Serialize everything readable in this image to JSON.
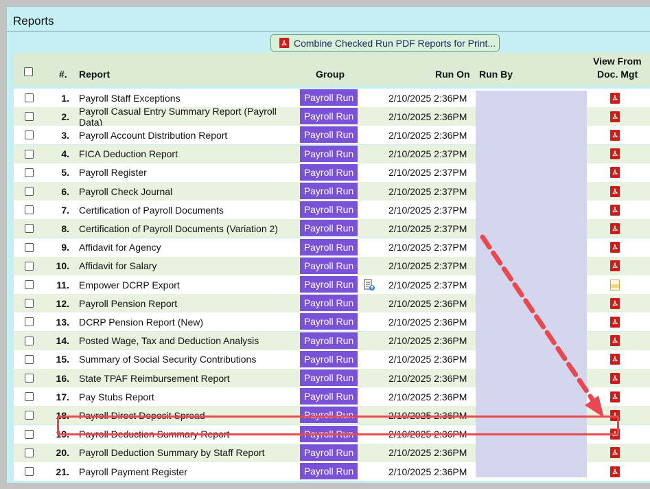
{
  "panel": {
    "title": "Reports"
  },
  "toolbar": {
    "combine_label": "Combine Checked Run PDF Reports for Print..."
  },
  "table": {
    "headers": {
      "num": "#.",
      "report": "Report",
      "group": "Group",
      "run_on": "Run On",
      "run_by": "Run By",
      "view_line1": "View From",
      "view_line2": "Doc. Mgt"
    },
    "rows": [
      {
        "num": "1.",
        "report": "Payroll Staff Exceptions",
        "group": "Payroll Run",
        "run_on": "2/10/2025 2:36PM",
        "file": "pdf"
      },
      {
        "num": "2.",
        "report": "Payroll Casual Entry Summary Report (Payroll Data)",
        "group": "Payroll Run",
        "run_on": "2/10/2025 2:36PM",
        "file": "pdf"
      },
      {
        "num": "3.",
        "report": "Payroll Account Distribution Report",
        "group": "Payroll Run",
        "run_on": "2/10/2025 2:36PM",
        "file": "pdf"
      },
      {
        "num": "4.",
        "report": "FICA Deduction Report",
        "group": "Payroll Run",
        "run_on": "2/10/2025 2:37PM",
        "file": "pdf"
      },
      {
        "num": "5.",
        "report": "Payroll Register",
        "group": "Payroll Run",
        "run_on": "2/10/2025 2:37PM",
        "file": "pdf"
      },
      {
        "num": "6.",
        "report": "Payroll Check Journal",
        "group": "Payroll Run",
        "run_on": "2/10/2025 2:37PM",
        "file": "pdf"
      },
      {
        "num": "7.",
        "report": "Certification of Payroll Documents",
        "group": "Payroll Run",
        "run_on": "2/10/2025 2:37PM",
        "file": "pdf"
      },
      {
        "num": "8.",
        "report": "Certification of Payroll Documents (Variation 2)",
        "group": "Payroll Run",
        "run_on": "2/10/2025 2:37PM",
        "file": "pdf"
      },
      {
        "num": "9.",
        "report": "Affidavit for Agency",
        "group": "Payroll Run",
        "run_on": "2/10/2025 2:37PM",
        "file": "pdf"
      },
      {
        "num": "10.",
        "report": "Affidavit for Salary",
        "group": "Payroll Run",
        "run_on": "2/10/2025 2:37PM",
        "file": "pdf"
      },
      {
        "num": "11.",
        "report": "Empower DCRP Export",
        "group": "Payroll Run",
        "run_on": "2/10/2025 2:37PM",
        "file": "csv",
        "extra_icon": true
      },
      {
        "num": "12.",
        "report": "Payroll Pension Report",
        "group": "Payroll Run",
        "run_on": "2/10/2025 2:36PM",
        "file": "pdf"
      },
      {
        "num": "13.",
        "report": "DCRP Pension Report (New)",
        "group": "Payroll Run",
        "run_on": "2/10/2025 2:36PM",
        "file": "pdf"
      },
      {
        "num": "14.",
        "report": "Posted Wage, Tax and Deduction Analysis",
        "group": "Payroll Run",
        "run_on": "2/10/2025 2:36PM",
        "file": "pdf"
      },
      {
        "num": "15.",
        "report": "Summary of Social Security Contributions",
        "group": "Payroll Run",
        "run_on": "2/10/2025 2:36PM",
        "file": "pdf"
      },
      {
        "num": "16.",
        "report": "State TPAF Reimbursement Report",
        "group": "Payroll Run",
        "run_on": "2/10/2025 2:36PM",
        "file": "pdf"
      },
      {
        "num": "17.",
        "report": "Pay Stubs Report",
        "group": "Payroll Run",
        "run_on": "2/10/2025 2:36PM",
        "file": "pdf"
      },
      {
        "num": "18.",
        "report": "Payroll Direct Deposit Spread",
        "group": "Payroll Run",
        "run_on": "2/10/2025 2:36PM",
        "file": "pdf"
      },
      {
        "num": "19.",
        "report": "Payroll Deduction Summary Report",
        "group": "Payroll Run",
        "run_on": "2/10/2025 2:36PM",
        "file": "pdf"
      },
      {
        "num": "20.",
        "report": "Payroll Deduction Summary by Staff Report",
        "group": "Payroll Run",
        "run_on": "2/10/2025 2:36PM",
        "file": "pdf"
      },
      {
        "num": "21.",
        "report": "Payroll Payment Register",
        "group": "Payroll Run",
        "run_on": "2/10/2025 2:36PM",
        "file": "pdf"
      }
    ]
  },
  "colors": {
    "group_badge": "#7a52d8",
    "pdf_icon": "#cc1d1d",
    "annotation": "#e8484e",
    "header_bg": "#dcebd3"
  },
  "icons": {
    "combine": "pdf-icon",
    "view": "pdf-icon",
    "csv": "csv-file-icon",
    "export": "document-upload-icon"
  }
}
